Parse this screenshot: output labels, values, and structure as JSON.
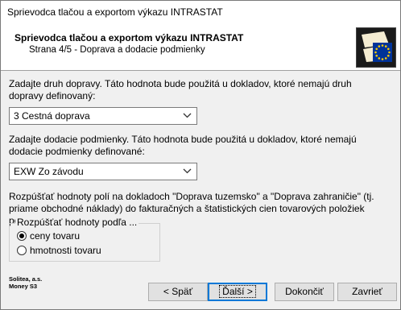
{
  "window": {
    "title": "Sprievodca tlačou a exportom výkazu INTRASTAT"
  },
  "header": {
    "title": "Sprievodca tlačou a exportom výkazu INTRASTAT",
    "subtitle": "Strana 4/5 - Doprava a dodacie podmienky"
  },
  "transport": {
    "instruction": "Zadajte druh dopravy. Táto hodnota bude použitá u dokladov, ktoré nemajú druh dopravy definovaný:",
    "selected": "3 Cestná doprava"
  },
  "delivery": {
    "instruction": "Zadajte dodacie podmienky. Táto hodnota bude použitá u dokladov, ktoré nemajú dodacie podmienky definované:",
    "selected": "EXW Zo závodu"
  },
  "distribution": {
    "instruction": "Rozpúšťať hodnoty polí na dokladoch \"Doprava tuzemsko\" a \"Doprava zahraničie\" (tj. priame obchodné náklady) do fakturačných a štatistických cien tovarových položiek pomerovo podľa...",
    "group_label": "Rozpúšťať hodnoty podľa ...",
    "options": [
      {
        "label": "ceny tovaru",
        "checked": true
      },
      {
        "label": "hmotnosti tovaru",
        "checked": false
      }
    ]
  },
  "company": {
    "line1": "Solitea, a.s.",
    "line2": "Money S3"
  },
  "buttons": {
    "back": "< Späť",
    "next": "Ďalší >",
    "finish": "Dokončiť",
    "close": "Zavrieť"
  },
  "icons": {
    "dropdown": "chevron-down-icon",
    "logo": "eu-flag-logo"
  },
  "colors": {
    "eu_blue": "#003399",
    "eu_gold": "#ffcc00",
    "default_button": "#0078d7"
  }
}
